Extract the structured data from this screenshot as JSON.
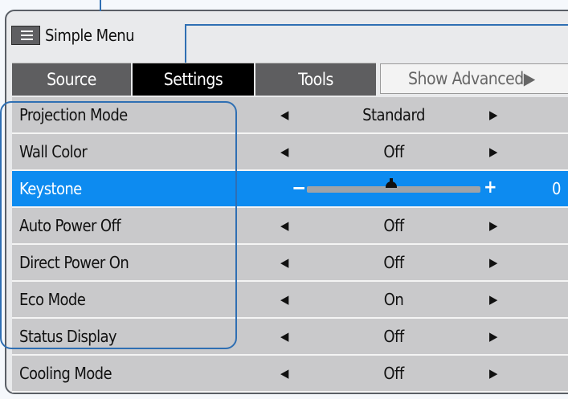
{
  "window": {
    "title": "Simple Menu"
  },
  "tabs": [
    {
      "label": "Source"
    },
    {
      "label": "Settings"
    },
    {
      "label": "Tools"
    },
    {
      "label": "Show Advanced▶"
    }
  ],
  "settings": [
    {
      "label": "Projection Mode",
      "value": "Standard"
    },
    {
      "label": "Wall Color",
      "value": "Off"
    },
    {
      "label": "Keystone",
      "minus": "−",
      "plus": "+",
      "value": "0",
      "level": 0.5
    },
    {
      "label": "Auto Power Off",
      "value": "Off"
    },
    {
      "label": "Direct Power On",
      "value": "Off"
    },
    {
      "label": "Eco Mode",
      "value": "On"
    },
    {
      "label": "Status Display",
      "value": "Off"
    },
    {
      "label": "Cooling Mode",
      "value": "Off"
    }
  ],
  "arrows": {
    "left": "◀",
    "right": "▶"
  },
  "colors": {
    "selected": "#0d8bf0",
    "active_tab": "#000000",
    "tab": "#5e5e60",
    "callout": "#2f6fb3"
  }
}
